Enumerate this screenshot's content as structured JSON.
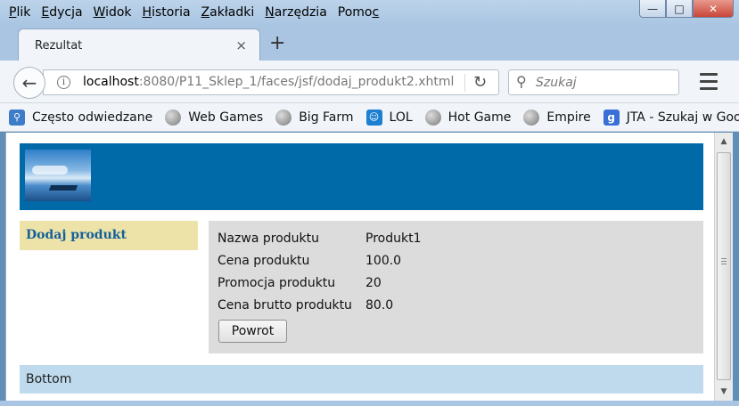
{
  "window": {
    "menu": [
      {
        "label": "Plik",
        "mnemonic": "P"
      },
      {
        "label": "Edycja",
        "mnemonic": "E"
      },
      {
        "label": "Widok",
        "mnemonic": "W"
      },
      {
        "label": "Historia",
        "mnemonic": "H"
      },
      {
        "label": "Zakładki",
        "mnemonic": "Z"
      },
      {
        "label": "Narzędzia",
        "mnemonic": "N"
      },
      {
        "label": "Pomoc",
        "mnemonic": "c"
      }
    ],
    "minimize_icon": "minimize-icon",
    "maximize_icon": "maximize-icon",
    "close_icon": "close-icon"
  },
  "tab": {
    "title": "Rezultat",
    "close_glyph": "×",
    "new_tab_glyph": "+"
  },
  "navbar": {
    "back_glyph": "←",
    "info_glyph": "i",
    "url_host": "localhost",
    "url_rest": ":8080/P11_Sklep_1/faces/jsf/dodaj_produkt2.xhtml",
    "reload_glyph": "↻",
    "search_placeholder": "Szukaj"
  },
  "bookmarks": [
    {
      "label": "Często odwiedzane",
      "icon": "frequent-icon"
    },
    {
      "label": "Web Games",
      "icon": "globe-icon"
    },
    {
      "label": "Big Farm",
      "icon": "globe-icon"
    },
    {
      "label": "LOL",
      "icon": "lol-icon"
    },
    {
      "label": "Hot Game",
      "icon": "globe-icon"
    },
    {
      "label": "Empire",
      "icon": "globe-icon"
    },
    {
      "label": "JTA - Szukaj w Google",
      "icon": "google-icon"
    }
  ],
  "page": {
    "sidebar_link": "Dodaj produkt",
    "rows": [
      {
        "label": "Nazwa produktu",
        "value": "Produkt1"
      },
      {
        "label": "Cena produktu",
        "value": "100.0"
      },
      {
        "label": "Promocja produktu",
        "value": "20"
      },
      {
        "label": "Cena brutto produktu",
        "value": "80.0"
      }
    ],
    "back_button": "Powrot",
    "footer": "Bottom"
  },
  "colors": {
    "header_band": "#0069a8",
    "sidebar_bg": "#ede3a9",
    "sidebar_link": "#15609a",
    "content_bg": "#dcdcdc",
    "footer_bg": "#bedaec"
  }
}
